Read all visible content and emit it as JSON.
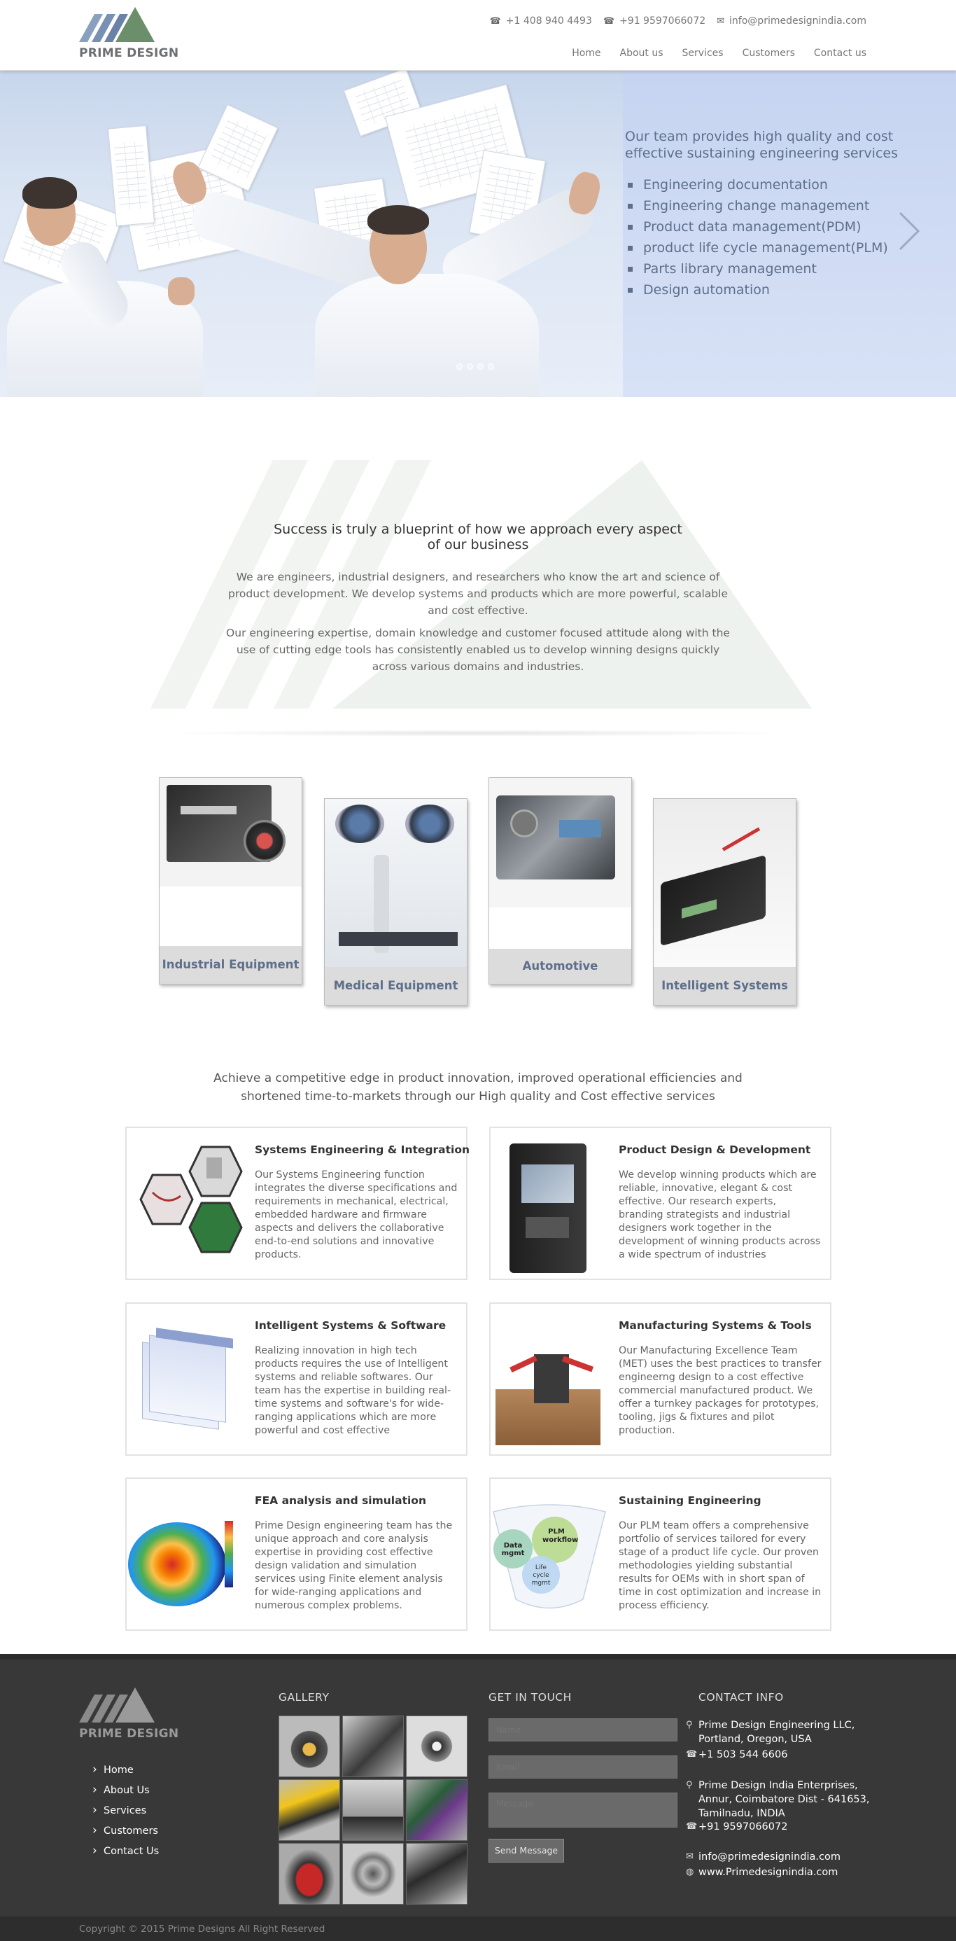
{
  "header": {
    "logo_text": "PRIME DESIGN",
    "phone_us": "+1 408 940 4493",
    "phone_in": "+91 9597066072",
    "email": "info@primedesignindia.com",
    "nav": [
      "Home",
      "About us",
      "Services",
      "Customers",
      "Contact us"
    ]
  },
  "hero": {
    "title": "Our team provides high quality and cost effective sustaining engineering services",
    "items": [
      "Engineering documentation",
      "Engineering change management",
      "Product data management(PDM)",
      "product life cycle management(PLM)",
      "Parts library management",
      "Design automation"
    ],
    "slide_count": 4
  },
  "intro": {
    "title": "Success is truly a blueprint of how we approach every aspect of our business",
    "p1": "We are engineers, industrial designers, and researchers who know the art and science of product development. We develop systems and products which are more powerful, scalable and cost effective.",
    "p2": "Our engineering expertise, domain knowledge and customer focused attitude along with the use of cutting edge tools has consistently enabled us to develop winning designs quickly across various domains and industries."
  },
  "industries": [
    {
      "label": "Industrial Equipment"
    },
    {
      "label": "Medical Equipment"
    },
    {
      "label": "Automotive"
    },
    {
      "label": "Intelligent Systems"
    }
  ],
  "tagline": "Achieve a competitive edge in product innovation, improved operational efficiencies and shortened time-to-markets through our High quality and Cost effective services",
  "services": [
    {
      "title": "Systems Engineering & Integration",
      "desc": "Our Systems Engineering function integrates the diverse specifications and requirements in mechanical, electrical, embedded hardware and firmware aspects and delivers the collaborative end-to-end solutions and innovative products."
    },
    {
      "title": "Product Design & Development",
      "desc": "We develop winning products which are reliable, innovative, elegant & cost effective. Our research experts, branding strategists and industrial designers work together in the development of winning products across a wide spectrum of industries"
    },
    {
      "title": "Intelligent Systems & Software",
      "desc": "Realizing innovation in high tech products requires the use of Intelligent systems and reliable softwares. Our team has the expertise in building real-time systems and software's for wide-ranging applications which are more powerful and cost effective"
    },
    {
      "title": "Manufacturing Systems & Tools",
      "desc": "Our Manufacturing Excellence Team (MET) uses the best practices to transfer engineerng design to a cost effective commercial manufactured product. We offer a turnkey packages for prototypes, tooling, jigs & fixtures and pilot production."
    },
    {
      "title": "FEA analysis and simulation",
      "desc": "Prime Design engineering team has the unique approach and core analysis expertise in providing cost effective design validation and simulation services using Finite element analysis for wide-ranging applications and numerous complex problems."
    },
    {
      "title": "Sustaining Engineering",
      "desc": "Our PLM team offers a comprehensive portfolio of services tailored for every stage of a product life cycle. Our proven methodologies yielding substantial results for OEMs with in short span of time in cost optimization and increase in process efficiency."
    }
  ],
  "diagram": {
    "data": "Data mgmt",
    "plm": "PLM workflow",
    "life": "Life cycle mgmt"
  },
  "footer": {
    "logo_text": "PRIME DESIGN",
    "links": [
      "Home",
      "About Us",
      "Services",
      "Customers",
      "Contact Us"
    ],
    "gallery_heading": "GALLERY",
    "touch_heading": "GET IN TOUCH",
    "name_placeholder": "Name",
    "email_placeholder": "Email",
    "message_placeholder": "Message",
    "send_label": "Send Message",
    "contact_heading": "CONTACT INFO",
    "us_address": "Prime Design Engineering LLC, Portland, Oregon, USA",
    "us_phone": "+1 503 544 6606",
    "in_address": "Prime Design India Enterprises, Annur, Coimbatore Dist - 641653, Tamilnadu, INDIA",
    "in_phone": "+91 9597066072",
    "email": "info@primedesignindia.com",
    "web": "www.Primedesignindia.com",
    "copyright": "Copyright © 2015 Prime Designs All Right Reserved"
  },
  "colors": {
    "accent": "#5e6f8b",
    "footer_bg": "#383838",
    "logo_green": "#6b8f6b",
    "logo_blue": "#6f86a8"
  }
}
